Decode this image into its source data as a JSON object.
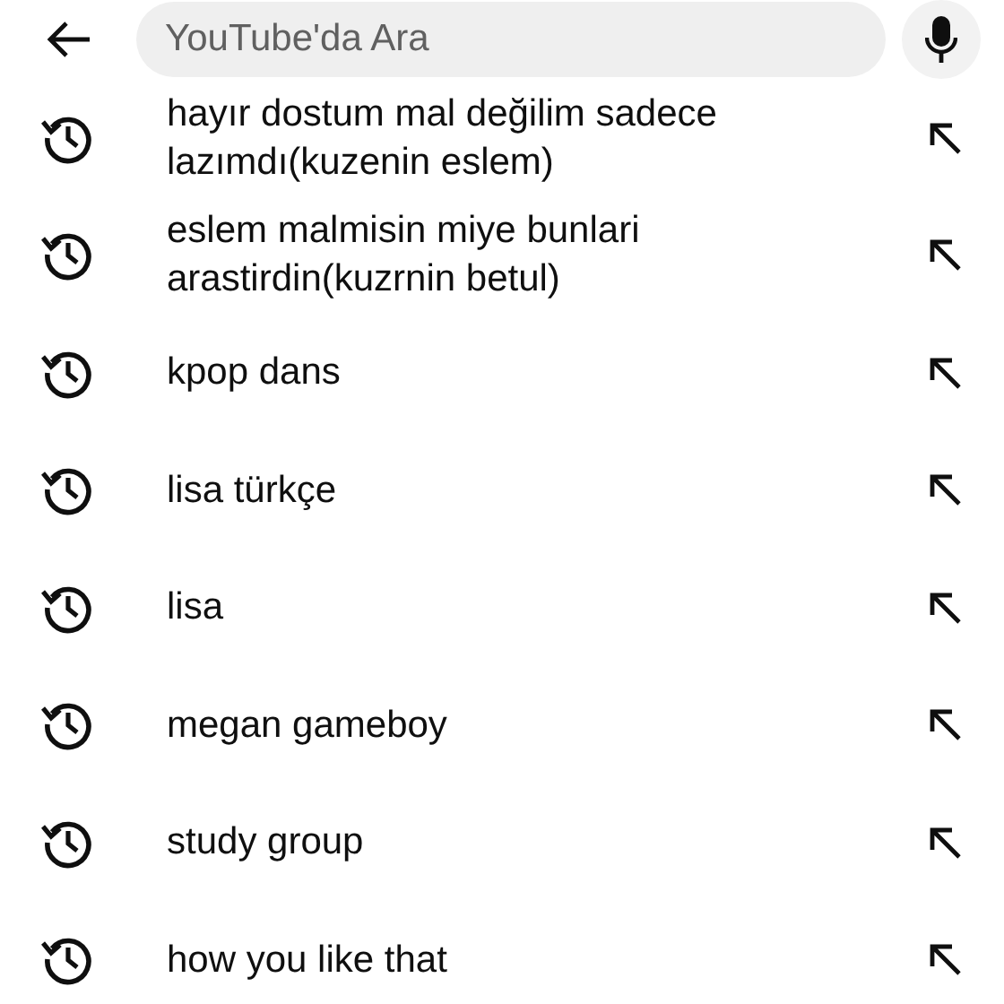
{
  "search": {
    "placeholder": "YouTube'da Ara"
  },
  "history": [
    {
      "text": "hayır dostum mal değilim sadece lazımdı(kuzenin eslem)"
    },
    {
      "text": "eslem malmisin miye bunlari arastirdin(kuzrnin betul)"
    },
    {
      "text": "kpop dans"
    },
    {
      "text": "lisa türkçe"
    },
    {
      "text": "lisa"
    },
    {
      "text": "megan gameboy"
    },
    {
      "text": "study group"
    },
    {
      "text": "how you like that"
    }
  ]
}
